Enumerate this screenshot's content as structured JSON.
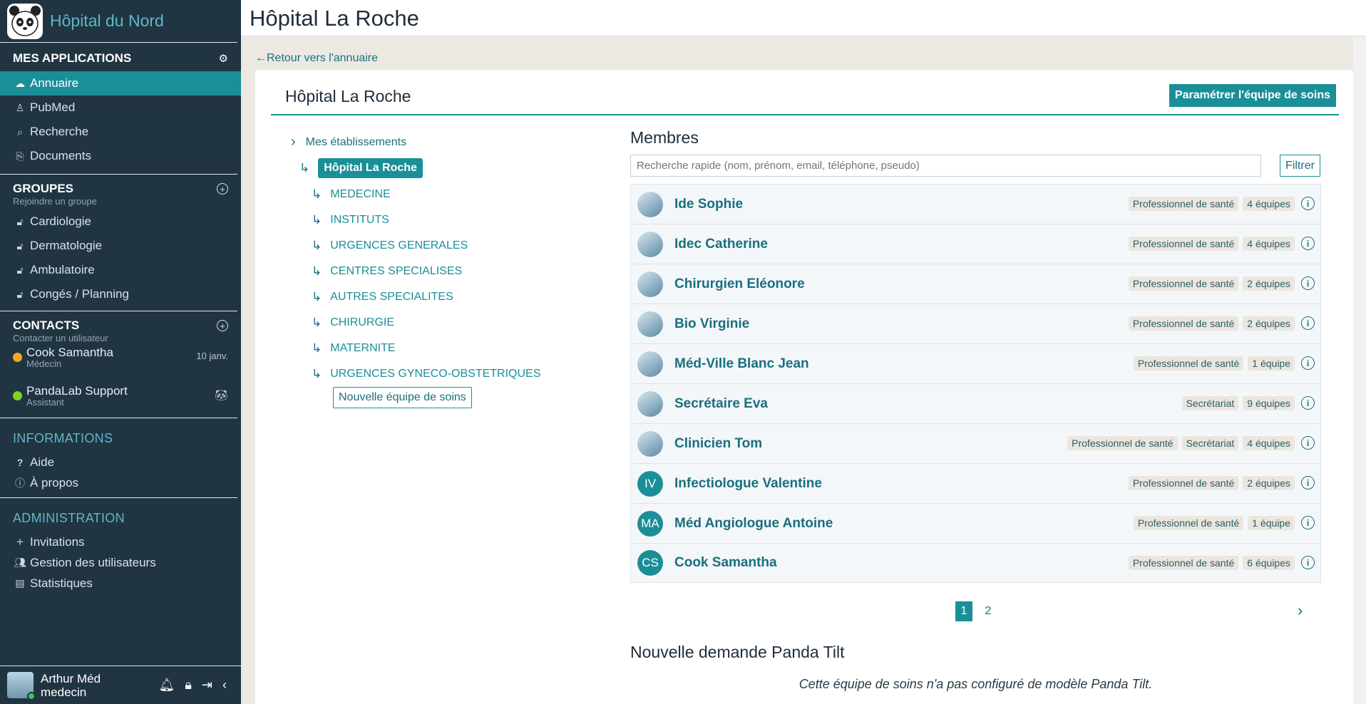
{
  "app": {
    "name": "Hôpital du Nord"
  },
  "sidebar": {
    "applications": {
      "heading": "MES APPLICATIONS",
      "items": [
        {
          "label": "Annuaire",
          "icon": "cloud-icon",
          "active": true
        },
        {
          "label": "PubMed",
          "icon": "pubmed-icon"
        },
        {
          "label": "Recherche",
          "icon": "search-icon"
        },
        {
          "label": "Documents",
          "icon": "paperclip-icon"
        }
      ]
    },
    "groups": {
      "heading": "GROUPES",
      "sub": "Rejoindre un groupe",
      "items": [
        {
          "label": "Cardiologie"
        },
        {
          "label": "Dermatologie"
        },
        {
          "label": "Ambulatoire"
        },
        {
          "label": "Congés / Planning"
        }
      ]
    },
    "contacts": {
      "heading": "CONTACTS",
      "sub": "Contacter un utilisateur",
      "items": [
        {
          "name": "Cook Samantha",
          "role": "Médecin",
          "date": "10 janv.",
          "status_color": "#f5a623"
        },
        {
          "name": "PandaLab Support",
          "role": "Assistant",
          "status_color": "#7ed321"
        }
      ]
    },
    "informations": {
      "heading": "INFORMATIONS",
      "items": [
        {
          "label": "Aide",
          "icon": "question-icon"
        },
        {
          "label": "À propos",
          "icon": "info-icon"
        }
      ]
    },
    "administration": {
      "heading": "ADMINISTRATION",
      "items": [
        {
          "label": "Invitations",
          "icon": "plus-icon"
        },
        {
          "label": "Gestion des utilisateurs",
          "icon": "users-icon"
        },
        {
          "label": "Statistiques",
          "icon": "chart-icon"
        }
      ]
    },
    "user": {
      "name": "Arthur Méd",
      "role": "medecin"
    }
  },
  "page": {
    "title": "Hôpital La Roche",
    "back_link": "Retour vers l'annuaire",
    "card_title": "Hôpital La Roche",
    "configure_button": "Paramétrer l'équipe de soins"
  },
  "tree": {
    "root": "Mes établissements",
    "active": "Hôpital La Roche",
    "children": [
      "MEDECINE",
      "INSTITUTS",
      "URGENCES GENERALES",
      "CENTRES SPECIALISES",
      "AUTRES SPECIALITES",
      "CHIRURGIE",
      "MATERNITE",
      "URGENCES GYNECO-OBSTETRIQUES"
    ],
    "new_team_button": "Nouvelle équipe de soins"
  },
  "members": {
    "title": "Membres",
    "search_placeholder": "Recherche rapide (nom, prénom, email, téléphone, pseudo)",
    "filter_button": "Filtrer",
    "rows": [
      {
        "name": "Ide Sophie",
        "tags": [
          "Professionnel de santé"
        ],
        "teams": "4 équipes",
        "avatar": "photo"
      },
      {
        "name": "Idec Catherine",
        "tags": [
          "Professionnel de santé"
        ],
        "teams": "4 équipes",
        "avatar": "photo"
      },
      {
        "name": "Chirurgien Eléonore",
        "tags": [
          "Professionnel de santé"
        ],
        "teams": "2 équipes",
        "avatar": "photo"
      },
      {
        "name": "Bio Virginie",
        "tags": [
          "Professionnel de santé"
        ],
        "teams": "2 équipes",
        "avatar": "photo"
      },
      {
        "name": "Méd-Ville Blanc Jean",
        "tags": [
          "Professionnel de santé"
        ],
        "teams": "1 équipe",
        "avatar": "photo"
      },
      {
        "name": "Secrétaire Eva",
        "tags": [
          "Secrétariat"
        ],
        "teams": "9 équipes",
        "avatar": "photo"
      },
      {
        "name": "Clinicien Tom",
        "tags": [
          "Professionnel de santé",
          "Secrétariat"
        ],
        "teams": "4 équipes",
        "avatar": "photo"
      },
      {
        "name": "Infectiologue Valentine",
        "tags": [
          "Professionnel de santé"
        ],
        "teams": "2 équipes",
        "avatar": "IV"
      },
      {
        "name": "Méd Angiologue Antoine",
        "tags": [
          "Professionnel de santé"
        ],
        "teams": "1 équipe",
        "avatar": "MA"
      },
      {
        "name": "Cook Samantha",
        "tags": [
          "Professionnel de santé"
        ],
        "teams": "6 équipes",
        "avatar": "CS"
      }
    ],
    "pages": [
      "1",
      "2"
    ],
    "current_page": "1"
  },
  "panda_tilt": {
    "title": "Nouvelle demande Panda Tilt",
    "note": "Cette équipe de soins n'a pas configuré de modèle Panda Tilt."
  },
  "colors": {
    "accent": "#1a8f98",
    "sidebar_bg": "#213442",
    "link": "#1a6f7f"
  }
}
